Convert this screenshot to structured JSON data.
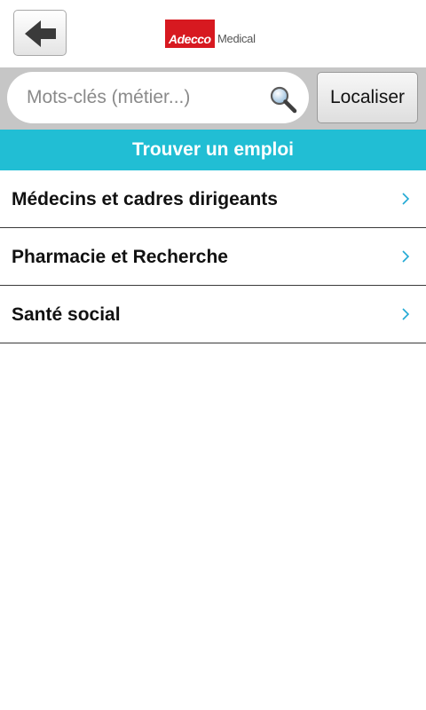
{
  "header": {
    "back_icon": "back-arrow-icon",
    "logo_brand": "Adecco",
    "logo_suffix": "Medical",
    "brand_color": "#d71920"
  },
  "search": {
    "placeholder": "Mots-clés (métier...)",
    "value": "",
    "icon": "magnifier-icon",
    "localiser_label": "Localiser"
  },
  "section": {
    "title": "Trouver un emploi",
    "color": "#21bed4"
  },
  "categories": [
    {
      "label": "Médecins et cadres dirigeants",
      "icon": "chevron-right-icon"
    },
    {
      "label": "Pharmacie et Recherche",
      "icon": "chevron-right-icon"
    },
    {
      "label": "Santé social",
      "icon": "chevron-right-icon"
    }
  ]
}
